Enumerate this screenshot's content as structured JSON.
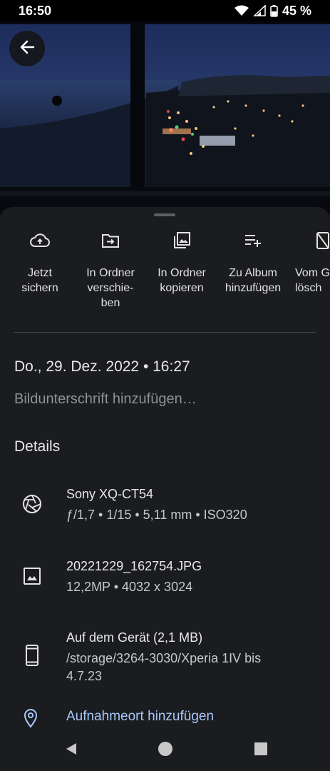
{
  "status_bar": {
    "time": "16:50",
    "battery": "45 %",
    "icons": [
      "wifi-icon",
      "signal-icon",
      "battery-icon"
    ]
  },
  "photo": {
    "description_icon": "photo-preview",
    "back_icon": "back-arrow-icon"
  },
  "actions": [
    {
      "label": "Jetzt\nsichern",
      "icon": "cloud-upload-icon"
    },
    {
      "label": "In Ordner\nverschie-\nben",
      "icon": "folder-move-icon"
    },
    {
      "label": "In Ordner\nkopieren",
      "icon": "copy-to-folder-icon"
    },
    {
      "label": "Zu Album\nhinzufügen",
      "icon": "playlist-add-icon"
    },
    {
      "label": "Vom G\nlösch",
      "icon": "phone-erase-icon"
    }
  ],
  "info": {
    "date": "Do., 29. Dez. 2022 • 16:27",
    "caption_placeholder": "Bildunterschrift hinzufügen…",
    "details_heading": "Details"
  },
  "details": {
    "camera": {
      "title": "Sony XQ-CT54",
      "sub": "ƒ/1,7  •  1/15  •  5,11 mm  •  ISO320",
      "icon": "aperture-icon"
    },
    "file": {
      "title": "20221229_162754.JPG",
      "sub": "12,2MP  •  4032 x 3024",
      "icon": "image-icon"
    },
    "storage": {
      "title": "Auf dem Gerät (2,1 MB)",
      "sub": "/storage/3264-3030/Xperia 1IV bis\n4.7.23",
      "icon": "smartphone-icon"
    },
    "location": {
      "link": "Aufnahmeort hinzufügen",
      "icon": "location-pin-icon"
    }
  },
  "colors": {
    "sheet_bg": "#1b1c1f",
    "link": "#a8c7fa",
    "muted_text": "#8e9196"
  }
}
